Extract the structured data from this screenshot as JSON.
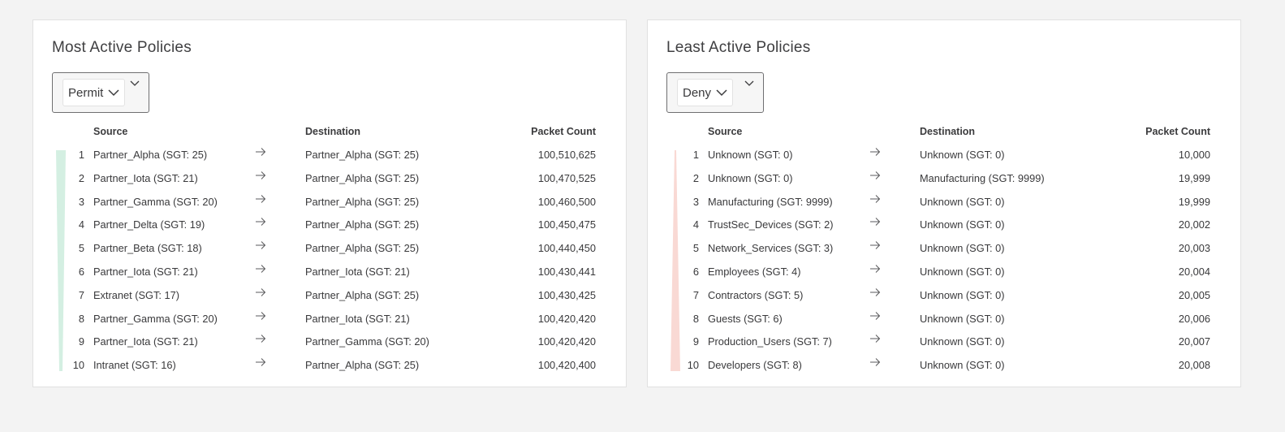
{
  "colors": {
    "most_bar": "#d4efe2",
    "least_bar": "#f9d9d4"
  },
  "most": {
    "title": "Most Active Policies",
    "filter": "Permit",
    "headers": {
      "source": "Source",
      "destination": "Destination",
      "count": "Packet Count"
    },
    "rows": [
      {
        "num": "1",
        "source": "Partner_Alpha (SGT: 25)",
        "destination": "Partner_Alpha (SGT: 25)",
        "count": "100,510,625"
      },
      {
        "num": "2",
        "source": "Partner_Iota (SGT: 21)",
        "destination": "Partner_Alpha (SGT: 25)",
        "count": "100,470,525"
      },
      {
        "num": "3",
        "source": "Partner_Gamma (SGT: 20)",
        "destination": "Partner_Alpha (SGT: 25)",
        "count": "100,460,500"
      },
      {
        "num": "4",
        "source": "Partner_Delta (SGT: 19)",
        "destination": "Partner_Alpha (SGT: 25)",
        "count": "100,450,475"
      },
      {
        "num": "5",
        "source": "Partner_Beta (SGT: 18)",
        "destination": "Partner_Alpha (SGT: 25)",
        "count": "100,440,450"
      },
      {
        "num": "6",
        "source": "Partner_Iota (SGT: 21)",
        "destination": "Partner_Iota (SGT: 21)",
        "count": "100,430,441"
      },
      {
        "num": "7",
        "source": "Extranet (SGT: 17)",
        "destination": "Partner_Alpha (SGT: 25)",
        "count": "100,430,425"
      },
      {
        "num": "8",
        "source": "Partner_Gamma (SGT: 20)",
        "destination": "Partner_Iota (SGT: 21)",
        "count": "100,420,420"
      },
      {
        "num": "9",
        "source": "Partner_Iota (SGT: 21)",
        "destination": "Partner_Gamma (SGT: 20)",
        "count": "100,420,420"
      },
      {
        "num": "10",
        "source": "Intranet (SGT: 16)",
        "destination": "Partner_Alpha (SGT: 25)",
        "count": "100,420,400"
      }
    ]
  },
  "least": {
    "title": "Least Active Policies",
    "filter": "Deny",
    "headers": {
      "source": "Source",
      "destination": "Destination",
      "count": "Packet Count"
    },
    "rows": [
      {
        "num": "1",
        "source": "Unknown (SGT: 0)",
        "destination": "Unknown (SGT: 0)",
        "count": "10,000"
      },
      {
        "num": "2",
        "source": "Unknown (SGT: 0)",
        "destination": "Manufacturing (SGT: 9999)",
        "count": "19,999"
      },
      {
        "num": "3",
        "source": "Manufacturing (SGT: 9999)",
        "destination": "Unknown (SGT: 0)",
        "count": "19,999"
      },
      {
        "num": "4",
        "source": "TrustSec_Devices (SGT: 2)",
        "destination": "Unknown (SGT: 0)",
        "count": "20,002"
      },
      {
        "num": "5",
        "source": "Network_Services (SGT: 3)",
        "destination": "Unknown (SGT: 0)",
        "count": "20,003"
      },
      {
        "num": "6",
        "source": "Employees (SGT: 4)",
        "destination": "Unknown (SGT: 0)",
        "count": "20,004"
      },
      {
        "num": "7",
        "source": "Contractors (SGT: 5)",
        "destination": "Unknown (SGT: 0)",
        "count": "20,005"
      },
      {
        "num": "8",
        "source": "Guests (SGT: 6)",
        "destination": "Unknown (SGT: 0)",
        "count": "20,006"
      },
      {
        "num": "9",
        "source": "Production_Users (SGT: 7)",
        "destination": "Unknown (SGT: 0)",
        "count": "20,007"
      },
      {
        "num": "10",
        "source": "Developers (SGT: 8)",
        "destination": "Unknown (SGT: 0)",
        "count": "20,008"
      }
    ]
  }
}
